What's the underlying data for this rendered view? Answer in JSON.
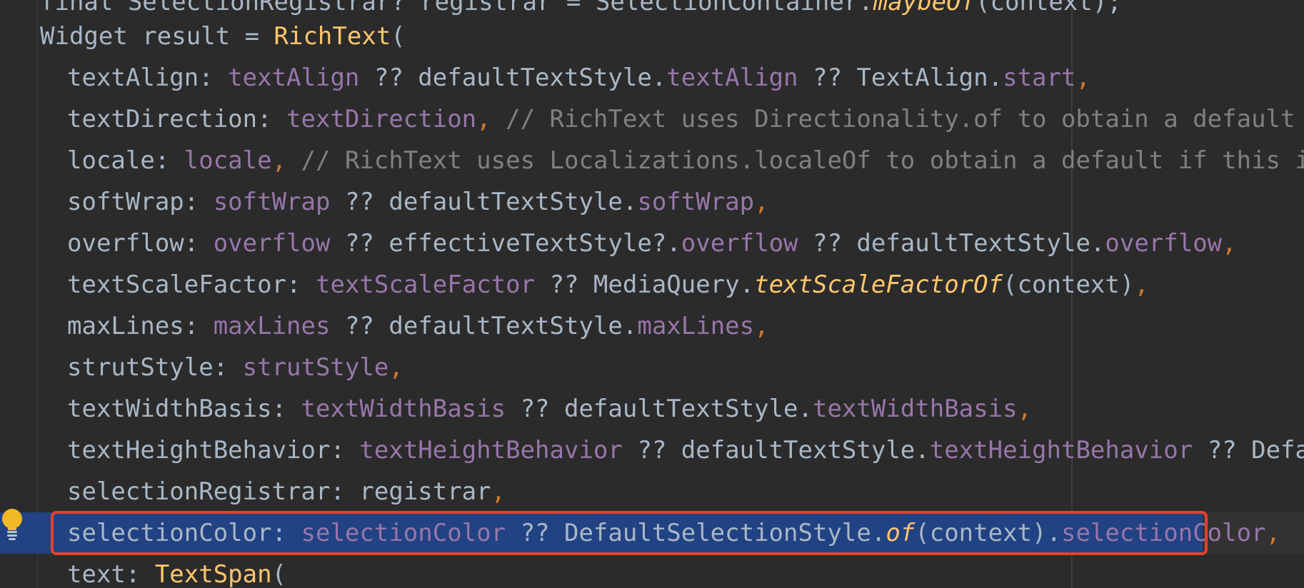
{
  "editor": {
    "colors": {
      "background": "#2b2b2b",
      "plain": "#a9b7c6",
      "property": "#9876aa",
      "punctuation": "#cc7832",
      "class_or_method": "#ffc66d",
      "comment": "#808080",
      "selection": "#214283",
      "highlight_border": "#e0432f",
      "intention_bulb": "#f2b826"
    },
    "lines": [
      {
        "id": "line-0",
        "tokens": [
          {
            "t": "final SelectionRegistrar? registrar = SelectionContainer.",
            "c": "plain"
          },
          {
            "t": "maybeOf",
            "c": "italic"
          },
          {
            "t": "(context);",
            "c": "plain"
          }
        ]
      },
      {
        "id": "line-1",
        "tokens": [
          {
            "t": "Widget result = ",
            "c": "plain"
          },
          {
            "t": "RichText",
            "c": "class"
          },
          {
            "t": "(",
            "c": "plain"
          }
        ]
      },
      {
        "id": "line-2",
        "tokens": [
          {
            "t": "textAlign: ",
            "c": "plain"
          },
          {
            "t": "textAlign",
            "c": "prop"
          },
          {
            "t": " ?? defaultTextStyle.",
            "c": "plain"
          },
          {
            "t": "textAlign",
            "c": "prop"
          },
          {
            "t": " ?? TextAlign.",
            "c": "plain"
          },
          {
            "t": "start",
            "c": "prop"
          },
          {
            "t": ",",
            "c": "punct"
          }
        ]
      },
      {
        "id": "line-3",
        "tokens": [
          {
            "t": "textDirection: ",
            "c": "plain"
          },
          {
            "t": "textDirection",
            "c": "prop"
          },
          {
            "t": ",",
            "c": "punct"
          },
          {
            "t": " // RichText uses Directionality.of to obtain a default if thi",
            "c": "comment"
          }
        ]
      },
      {
        "id": "line-4",
        "tokens": [
          {
            "t": "locale: ",
            "c": "plain"
          },
          {
            "t": "locale",
            "c": "prop"
          },
          {
            "t": ",",
            "c": "punct"
          },
          {
            "t": " // RichText uses Localizations.localeOf to obtain a default if this is null",
            "c": "comment"
          }
        ]
      },
      {
        "id": "line-5",
        "tokens": [
          {
            "t": "softWrap: ",
            "c": "plain"
          },
          {
            "t": "softWrap",
            "c": "prop"
          },
          {
            "t": " ?? defaultTextStyle.",
            "c": "plain"
          },
          {
            "t": "softWrap",
            "c": "prop"
          },
          {
            "t": ",",
            "c": "punct"
          }
        ]
      },
      {
        "id": "line-6",
        "tokens": [
          {
            "t": "overflow: ",
            "c": "plain"
          },
          {
            "t": "overflow",
            "c": "prop"
          },
          {
            "t": " ?? effectiveTextStyle?.",
            "c": "plain"
          },
          {
            "t": "overflow",
            "c": "prop"
          },
          {
            "t": " ?? defaultTextStyle.",
            "c": "plain"
          },
          {
            "t": "overflow",
            "c": "prop"
          },
          {
            "t": ",",
            "c": "punct"
          }
        ]
      },
      {
        "id": "line-7",
        "tokens": [
          {
            "t": "textScaleFactor: ",
            "c": "plain"
          },
          {
            "t": "textScaleFactor",
            "c": "prop"
          },
          {
            "t": " ?? MediaQuery.",
            "c": "plain"
          },
          {
            "t": "textScaleFactorOf",
            "c": "italic"
          },
          {
            "t": "(context)",
            "c": "plain"
          },
          {
            "t": ",",
            "c": "punct"
          }
        ]
      },
      {
        "id": "line-8",
        "tokens": [
          {
            "t": "maxLines: ",
            "c": "plain"
          },
          {
            "t": "maxLines",
            "c": "prop"
          },
          {
            "t": " ?? defaultTextStyle.",
            "c": "plain"
          },
          {
            "t": "maxLines",
            "c": "prop"
          },
          {
            "t": ",",
            "c": "punct"
          }
        ]
      },
      {
        "id": "line-9",
        "tokens": [
          {
            "t": "strutStyle: ",
            "c": "plain"
          },
          {
            "t": "strutStyle",
            "c": "prop"
          },
          {
            "t": ",",
            "c": "punct"
          }
        ]
      },
      {
        "id": "line-10",
        "tokens": [
          {
            "t": "textWidthBasis: ",
            "c": "plain"
          },
          {
            "t": "textWidthBasis",
            "c": "prop"
          },
          {
            "t": " ?? defaultTextStyle.",
            "c": "plain"
          },
          {
            "t": "textWidthBasis",
            "c": "prop"
          },
          {
            "t": ",",
            "c": "punct"
          }
        ]
      },
      {
        "id": "line-11",
        "tokens": [
          {
            "t": "textHeightBehavior: ",
            "c": "plain"
          },
          {
            "t": "textHeightBehavior",
            "c": "prop"
          },
          {
            "t": " ?? defaultTextStyle.",
            "c": "plain"
          },
          {
            "t": "textHeightBehavior",
            "c": "prop"
          },
          {
            "t": " ?? DefaultTex",
            "c": "plain"
          }
        ]
      },
      {
        "id": "line-12",
        "tokens": [
          {
            "t": "selectionRegistrar: registrar",
            "c": "plain"
          },
          {
            "t": ",",
            "c": "punct"
          }
        ]
      },
      {
        "id": "line-13",
        "selected": true,
        "tokens": [
          {
            "t": "selectionColor: ",
            "c": "plain"
          },
          {
            "t": "selectionColor",
            "c": "prop"
          },
          {
            "t": " ?? DefaultSelectionStyle.",
            "c": "plain"
          },
          {
            "t": "of",
            "c": "italic"
          },
          {
            "t": "(context).",
            "c": "plain"
          },
          {
            "t": "selectionColor",
            "c": "prop"
          },
          {
            "t": ",",
            "c": "punct"
          }
        ]
      },
      {
        "id": "line-14",
        "tokens": [
          {
            "t": "text: ",
            "c": "plain"
          },
          {
            "t": "TextSpan",
            "c": "class"
          },
          {
            "t": "(",
            "c": "plain"
          }
        ]
      }
    ],
    "intention_icon": "lightbulb-icon"
  }
}
